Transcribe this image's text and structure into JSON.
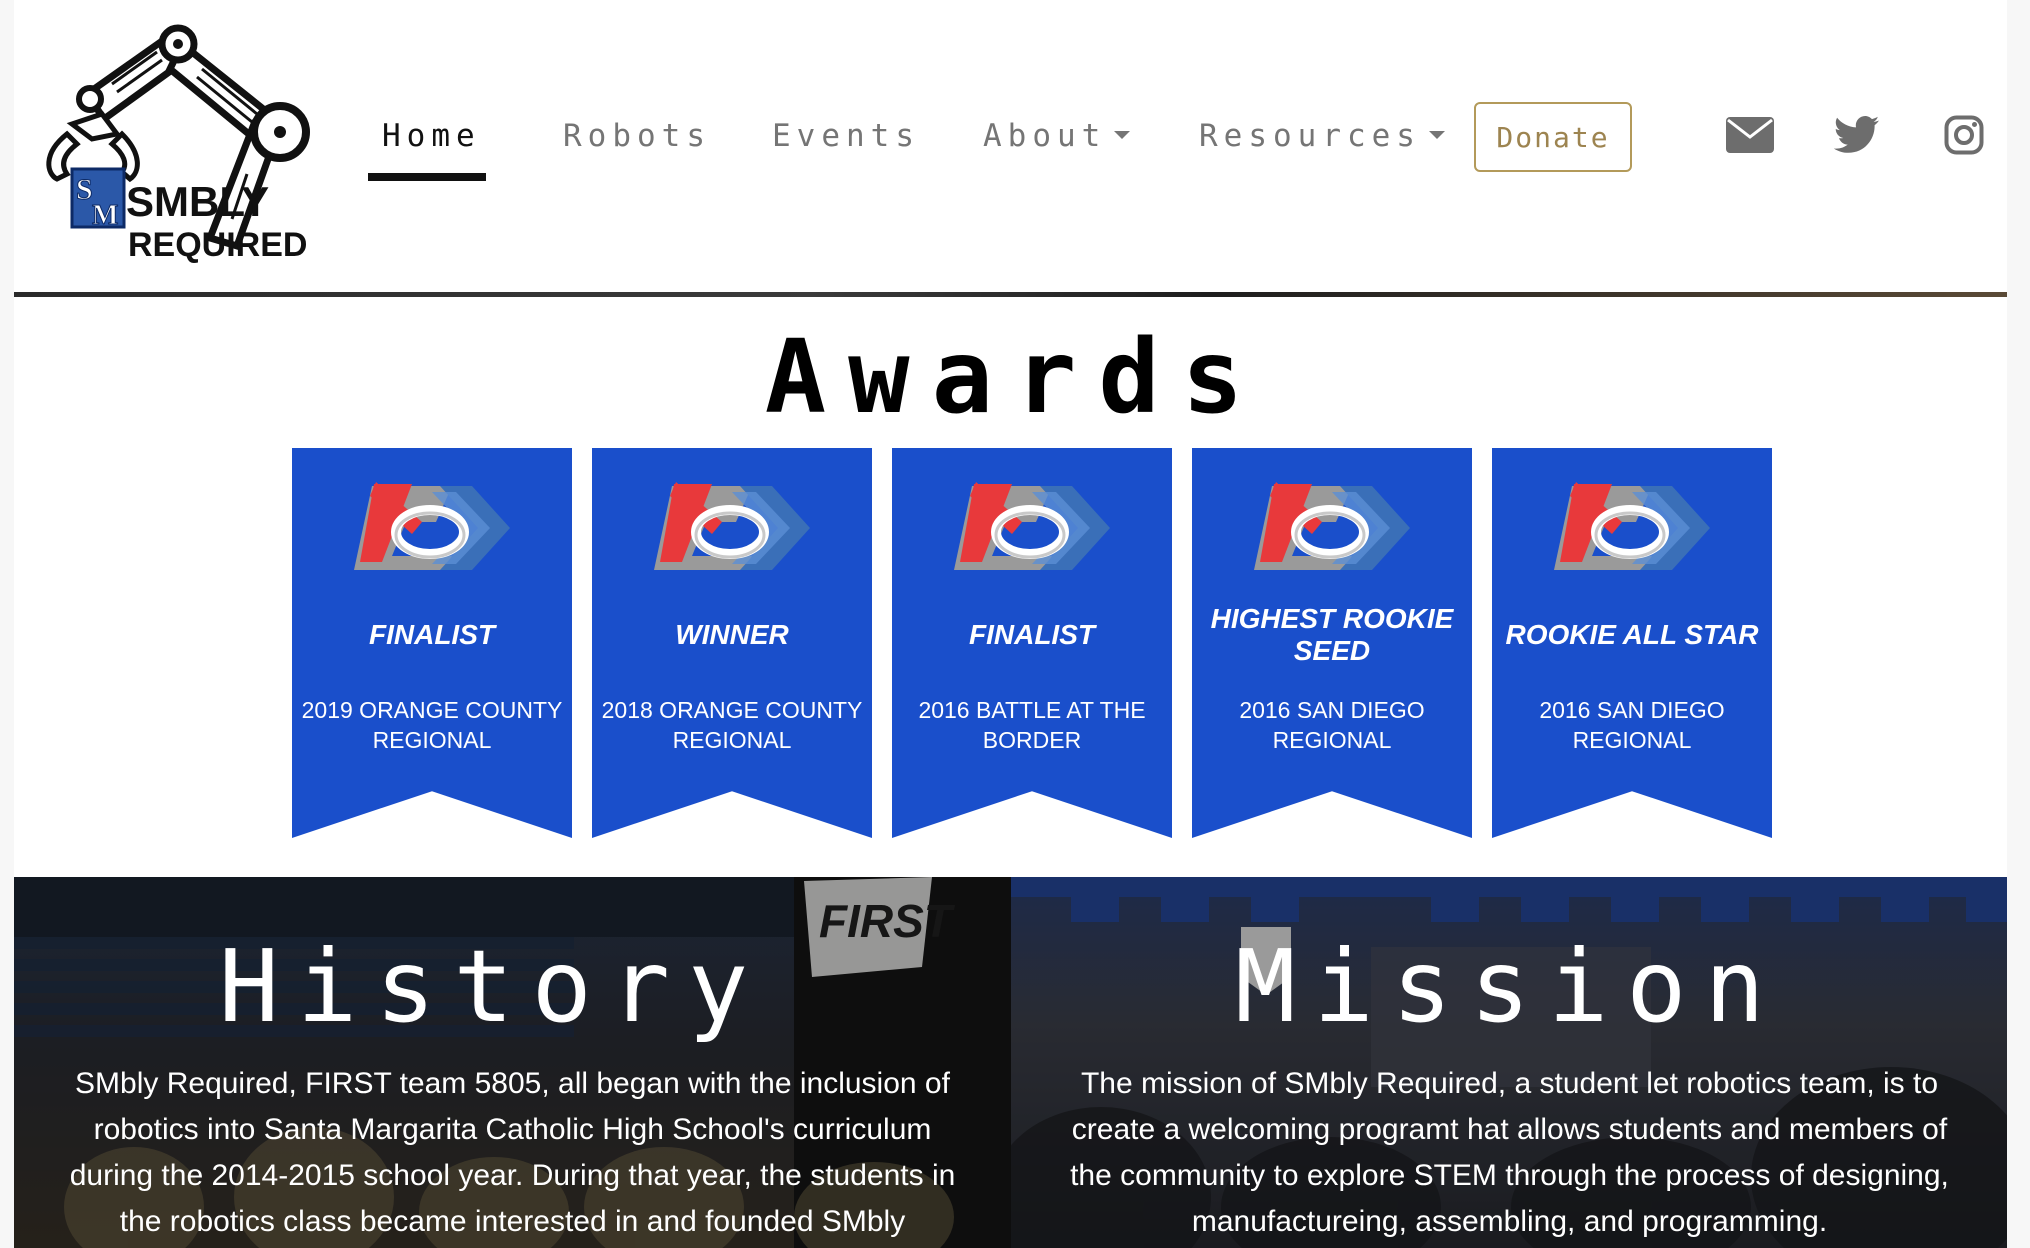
{
  "nav": {
    "logo_text_line1": "SMBLY",
    "logo_text_line2": "REQUIRED",
    "links": [
      {
        "label": "Home",
        "active": true
      },
      {
        "label": "Robots"
      },
      {
        "label": "Events"
      },
      {
        "label": "About",
        "dropdown": true
      },
      {
        "label": "Resources",
        "dropdown": true
      }
    ],
    "donate_label": "Donate",
    "social_icons": [
      "envelope-icon",
      "twitter-icon",
      "instagram-icon"
    ]
  },
  "awards": {
    "title": "Awards",
    "items": [
      {
        "title": "FINALIST",
        "event": "2019 ORANGE COUNTY REGIONAL"
      },
      {
        "title": "WINNER",
        "event": "2018 ORANGE COUNTY REGIONAL"
      },
      {
        "title": "FINALIST",
        "event": "2016 BATTLE AT THE BORDER"
      },
      {
        "title": "HIGHEST ROOKIE SEED",
        "event": "2016 SAN DIEGO REGIONAL"
      },
      {
        "title": "ROOKIE ALL STAR",
        "event": "2016 SAN DIEGO REGIONAL"
      }
    ]
  },
  "history": {
    "title": "History",
    "text": "SMbly Required, FIRST team 5805, all began with the inclusion of robotics into Santa Margarita Catholic High School's curriculum during the 2014-2015 school year. During that year, the students in the robotics class became interested in and founded SMbly"
  },
  "mission": {
    "title": "Mission",
    "text": "The mission of SMbly Required, a student let robotics team, is to create a welcoming programt hat allows students and members of the community to explore STEM through the process of designing, manufactureing, assembling, and programming."
  },
  "colors": {
    "banner_blue": "#1a4fcb",
    "donate_gold": "#b39a5a",
    "nav_gray": "#757575",
    "first_red": "#e8393b",
    "first_blue": "#3a6fb8"
  }
}
